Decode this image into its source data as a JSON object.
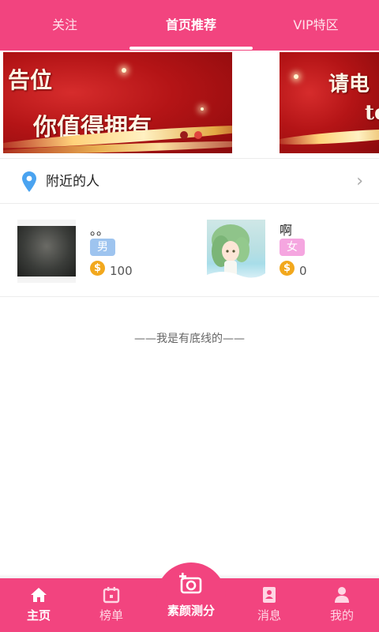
{
  "top_tabs": [
    {
      "label": "关注",
      "active": false
    },
    {
      "label": "首页推荐",
      "active": true
    },
    {
      "label": "VIP特区",
      "active": false
    }
  ],
  "banner": {
    "slide1_line1": "告位",
    "slide1_line2": "你值得拥有",
    "slide2_line1": "请电",
    "slide2_line2": "te",
    "dots": [
      "inactive",
      "active"
    ],
    "accent_color": "#b41416"
  },
  "nearby": {
    "label": "附近的人",
    "pin_icon": "location-pin-icon",
    "chevron": "›"
  },
  "users": [
    {
      "name": "。。",
      "gender": "男",
      "coins": "100",
      "coin_symbol": "$"
    },
    {
      "name": "啊",
      "gender": "女",
      "coins": "0",
      "coin_symbol": "$"
    }
  ],
  "end_text": "——我是有底线的——",
  "bottom_nav": [
    {
      "label": "主页",
      "icon": "home-icon",
      "active": true
    },
    {
      "label": "榜单",
      "icon": "calendar-icon",
      "active": false
    },
    {
      "label": "素颜测分",
      "icon": "camera-plus-icon",
      "active": false
    },
    {
      "label": "消息",
      "icon": "contact-card-icon",
      "active": false
    },
    {
      "label": "我的",
      "icon": "person-icon",
      "active": false
    }
  ],
  "colors": {
    "primary": "#f2447f",
    "male_badge": "#9ec4ef",
    "female_badge": "#f5a6e0",
    "coin": "#f2a81d",
    "pin": "#4aa3f0"
  }
}
